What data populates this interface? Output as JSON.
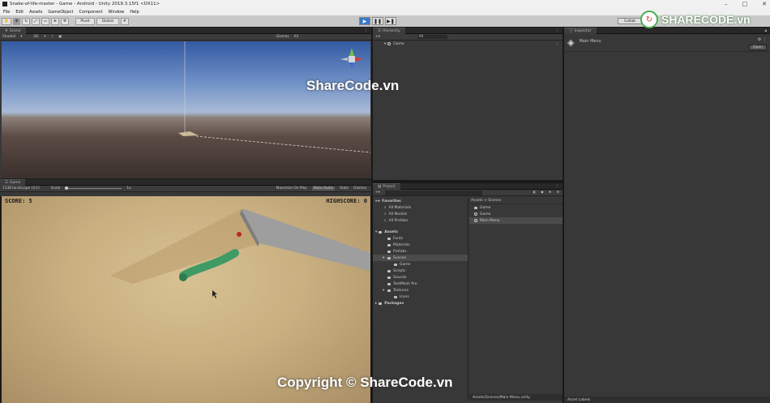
{
  "window": {
    "title": "Snake-of-life-master - Game - Android - Unity 2019.3.15f1 <DX11>"
  },
  "menu": [
    "File",
    "Edit",
    "Assets",
    "GameObject",
    "Component",
    "Window",
    "Help"
  ],
  "toolbar": {
    "pivot": "Pivot",
    "global": "Global"
  },
  "scene_tab": {
    "label": "Scene",
    "shading": "Shaded",
    "mode": "2D",
    "gizmos": "Gizmos",
    "search": "All"
  },
  "game_tab": {
    "label": "Game",
    "display": "1138 landscape (3:1)",
    "scale_label": "Scale",
    "scale_value": "1x",
    "maximize": "Maximize On Play",
    "mute": "Mute Audio",
    "stats": "Stats",
    "gizmos": "Gizmos"
  },
  "game_ui": {
    "score": "SCORE: 5",
    "highscore": "HIGHSCORE: 0"
  },
  "hierarchy": {
    "tab": "Hierarchy",
    "search": "All",
    "scene": "Game"
  },
  "project": {
    "tab": "Project",
    "favorites_label": "Favorites",
    "favorites": [
      "All Materials",
      "All Models",
      "All Prefabs"
    ],
    "assets_label": "Assets",
    "assets_tree": [
      {
        "label": "Fonts",
        "depth": 1,
        "open": false
      },
      {
        "label": "Materials",
        "depth": 1,
        "open": false
      },
      {
        "label": "Prefabs",
        "depth": 1,
        "open": false
      },
      {
        "label": "Scenes",
        "depth": 1,
        "open": true,
        "selected": true
      },
      {
        "label": "Game",
        "depth": 2,
        "open": false
      },
      {
        "label": "Scripts",
        "depth": 1,
        "open": false
      },
      {
        "label": "Sounds",
        "depth": 1,
        "open": false
      },
      {
        "label": "TextMesh Pro",
        "depth": 1,
        "open": false
      },
      {
        "label": "Textures",
        "depth": 1,
        "open": true
      },
      {
        "label": "Icons",
        "depth": 2,
        "open": false
      }
    ],
    "packages_label": "Packages",
    "breadcrumb": "Assets > Scenes",
    "files": [
      {
        "label": "Game",
        "type": "folder"
      },
      {
        "label": "Game",
        "type": "scene"
      },
      {
        "label": "Main Menu",
        "type": "scene",
        "selected": true
      }
    ],
    "footer": "Assets/Scenes/Main Menu.unity"
  },
  "inspector": {
    "tab": "Inspector",
    "asset": "Main Menu",
    "open_button": "Open",
    "footer": "Asset Labels"
  },
  "account": {
    "label": "Collab"
  },
  "watermarks": {
    "center": "ShareCode.vn",
    "logo": "SHARECODE.vn",
    "bottom": "Copyright © ShareCode.vn"
  },
  "colors": {
    "play_active": "#3a79c9",
    "panel": "#383838",
    "sand": "#c9b081",
    "snake": "#3f9a64",
    "apple": "#c0261a"
  }
}
